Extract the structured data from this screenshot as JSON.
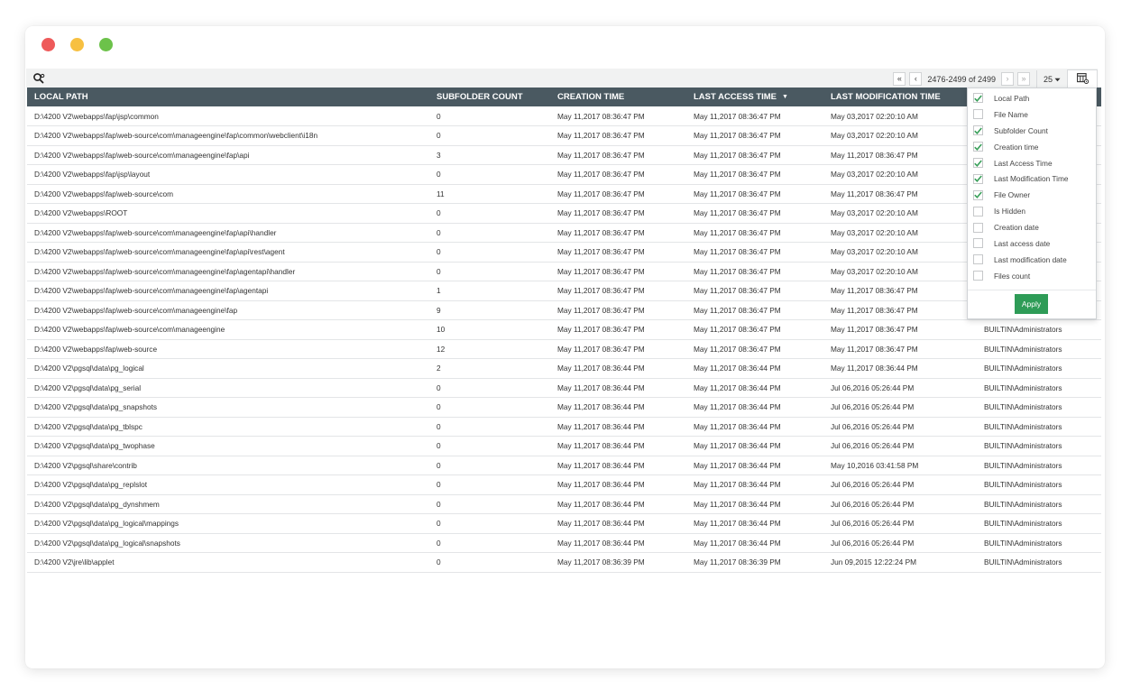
{
  "window": {
    "controls": [
      "close",
      "minimize",
      "maximize"
    ]
  },
  "toolbar": {
    "search_icon": "search-gear-icon",
    "pager": {
      "first": "«",
      "prev": "‹",
      "range": "2476-2499 of 2499",
      "next": "›",
      "last": "»",
      "per_page": "25"
    },
    "column_chooser_icon": "column-settings-icon"
  },
  "table": {
    "columns": [
      {
        "key": "local_path",
        "label": "LOCAL PATH"
      },
      {
        "key": "subfolder_count",
        "label": "SUBFOLDER COUNT"
      },
      {
        "key": "creation_time",
        "label": "CREATION TIME"
      },
      {
        "key": "last_access_time",
        "label": "LAST ACCESS TIME",
        "sorted": "desc"
      },
      {
        "key": "last_modification_time",
        "label": "LAST MODIFICATION TIME"
      },
      {
        "key": "file_owner",
        "label": ""
      }
    ],
    "rows": [
      [
        "D:\\4200 V2\\webapps\\fap\\jsp\\common",
        "0",
        "May 11,2017 08:36:47 PM",
        "May 11,2017 08:36:47 PM",
        "May 03,2017 02:20:10 AM",
        ""
      ],
      [
        "D:\\4200 V2\\webapps\\fap\\web-source\\com\\manageengine\\fap\\common\\webclient\\i18n",
        "0",
        "May 11,2017 08:36:47 PM",
        "May 11,2017 08:36:47 PM",
        "May 03,2017 02:20:10 AM",
        ""
      ],
      [
        "D:\\4200 V2\\webapps\\fap\\web-source\\com\\manageengine\\fap\\api",
        "3",
        "May 11,2017 08:36:47 PM",
        "May 11,2017 08:36:47 PM",
        "May 11,2017 08:36:47 PM",
        ""
      ],
      [
        "D:\\4200 V2\\webapps\\fap\\jsp\\layout",
        "0",
        "May 11,2017 08:36:47 PM",
        "May 11,2017 08:36:47 PM",
        "May 03,2017 02:20:10 AM",
        ""
      ],
      [
        "D:\\4200 V2\\webapps\\fap\\web-source\\com",
        "11",
        "May 11,2017 08:36:47 PM",
        "May 11,2017 08:36:47 PM",
        "May 11,2017 08:36:47 PM",
        ""
      ],
      [
        "D:\\4200 V2\\webapps\\ROOT",
        "0",
        "May 11,2017 08:36:47 PM",
        "May 11,2017 08:36:47 PM",
        "May 03,2017 02:20:10 AM",
        ""
      ],
      [
        "D:\\4200 V2\\webapps\\fap\\web-source\\com\\manageengine\\fap\\api\\handler",
        "0",
        "May 11,2017 08:36:47 PM",
        "May 11,2017 08:36:47 PM",
        "May 03,2017 02:20:10 AM",
        ""
      ],
      [
        "D:\\4200 V2\\webapps\\fap\\web-source\\com\\manageengine\\fap\\api\\rest\\agent",
        "0",
        "May 11,2017 08:36:47 PM",
        "May 11,2017 08:36:47 PM",
        "May 03,2017 02:20:10 AM",
        ""
      ],
      [
        "D:\\4200 V2\\webapps\\fap\\web-source\\com\\manageengine\\fap\\agentapi\\handler",
        "0",
        "May 11,2017 08:36:47 PM",
        "May 11,2017 08:36:47 PM",
        "May 03,2017 02:20:10 AM",
        ""
      ],
      [
        "D:\\4200 V2\\webapps\\fap\\web-source\\com\\manageengine\\fap\\agentapi",
        "1",
        "May 11,2017 08:36:47 PM",
        "May 11,2017 08:36:47 PM",
        "May 11,2017 08:36:47 PM",
        ""
      ],
      [
        "D:\\4200 V2\\webapps\\fap\\web-source\\com\\manageengine\\fap",
        "9",
        "May 11,2017 08:36:47 PM",
        "May 11,2017 08:36:47 PM",
        "May 11,2017 08:36:47 PM",
        ""
      ],
      [
        "D:\\4200 V2\\webapps\\fap\\web-source\\com\\manageengine",
        "10",
        "May 11,2017 08:36:47 PM",
        "May 11,2017 08:36:47 PM",
        "May 11,2017 08:36:47 PM",
        "BUILTIN\\Administrators"
      ],
      [
        "D:\\4200 V2\\webapps\\fap\\web-source",
        "12",
        "May 11,2017 08:36:47 PM",
        "May 11,2017 08:36:47 PM",
        "May 11,2017 08:36:47 PM",
        "BUILTIN\\Administrators"
      ],
      [
        "D:\\4200 V2\\pgsql\\data\\pg_logical",
        "2",
        "May 11,2017 08:36:44 PM",
        "May 11,2017 08:36:44 PM",
        "May 11,2017 08:36:44 PM",
        "BUILTIN\\Administrators"
      ],
      [
        "D:\\4200 V2\\pgsql\\data\\pg_serial",
        "0",
        "May 11,2017 08:36:44 PM",
        "May 11,2017 08:36:44 PM",
        "Jul 06,2016 05:26:44 PM",
        "BUILTIN\\Administrators"
      ],
      [
        "D:\\4200 V2\\pgsql\\data\\pg_snapshots",
        "0",
        "May 11,2017 08:36:44 PM",
        "May 11,2017 08:36:44 PM",
        "Jul 06,2016 05:26:44 PM",
        "BUILTIN\\Administrators"
      ],
      [
        "D:\\4200 V2\\pgsql\\data\\pg_tblspc",
        "0",
        "May 11,2017 08:36:44 PM",
        "May 11,2017 08:36:44 PM",
        "Jul 06,2016 05:26:44 PM",
        "BUILTIN\\Administrators"
      ],
      [
        "D:\\4200 V2\\pgsql\\data\\pg_twophase",
        "0",
        "May 11,2017 08:36:44 PM",
        "May 11,2017 08:36:44 PM",
        "Jul 06,2016 05:26:44 PM",
        "BUILTIN\\Administrators"
      ],
      [
        "D:\\4200 V2\\pgsql\\share\\contrib",
        "0",
        "May 11,2017 08:36:44 PM",
        "May 11,2017 08:36:44 PM",
        "May 10,2016 03:41:58 PM",
        "BUILTIN\\Administrators"
      ],
      [
        "D:\\4200 V2\\pgsql\\data\\pg_replslot",
        "0",
        "May 11,2017 08:36:44 PM",
        "May 11,2017 08:36:44 PM",
        "Jul 06,2016 05:26:44 PM",
        "BUILTIN\\Administrators"
      ],
      [
        "D:\\4200 V2\\pgsql\\data\\pg_dynshmem",
        "0",
        "May 11,2017 08:36:44 PM",
        "May 11,2017 08:36:44 PM",
        "Jul 06,2016 05:26:44 PM",
        "BUILTIN\\Administrators"
      ],
      [
        "D:\\4200 V2\\pgsql\\data\\pg_logical\\mappings",
        "0",
        "May 11,2017 08:36:44 PM",
        "May 11,2017 08:36:44 PM",
        "Jul 06,2016 05:26:44 PM",
        "BUILTIN\\Administrators"
      ],
      [
        "D:\\4200 V2\\pgsql\\data\\pg_logical\\snapshots",
        "0",
        "May 11,2017 08:36:44 PM",
        "May 11,2017 08:36:44 PM",
        "Jul 06,2016 05:26:44 PM",
        "BUILTIN\\Administrators"
      ],
      [
        "D:\\4200 V2\\jre\\lib\\applet",
        "0",
        "May 11,2017 08:36:39 PM",
        "May 11,2017 08:36:39 PM",
        "Jun 09,2015 12:22:24 PM",
        "BUILTIN\\Administrators"
      ]
    ]
  },
  "column_chooser": {
    "items": [
      {
        "label": "Local Path",
        "checked": true
      },
      {
        "label": "File Name",
        "checked": false
      },
      {
        "label": "Subfolder Count",
        "checked": true
      },
      {
        "label": "Creation time",
        "checked": true
      },
      {
        "label": "Last Access Time",
        "checked": true
      },
      {
        "label": "Last Modification Time",
        "checked": true
      },
      {
        "label": "File Owner",
        "checked": true
      },
      {
        "label": "Is Hidden",
        "checked": false
      },
      {
        "label": "Creation date",
        "checked": false
      },
      {
        "label": "Last access date",
        "checked": false
      },
      {
        "label": "Last modification date",
        "checked": false
      },
      {
        "label": "Files count",
        "checked": false
      }
    ],
    "apply_label": "Apply"
  },
  "colors": {
    "header_bg": "#4a5961",
    "toolbar_bg": "#f1f2f2",
    "check": "#3aa05a",
    "apply_bg": "#2e9c57",
    "close": "#ee5a5a",
    "minimize": "#f7c041",
    "maximize": "#6cc24a"
  }
}
